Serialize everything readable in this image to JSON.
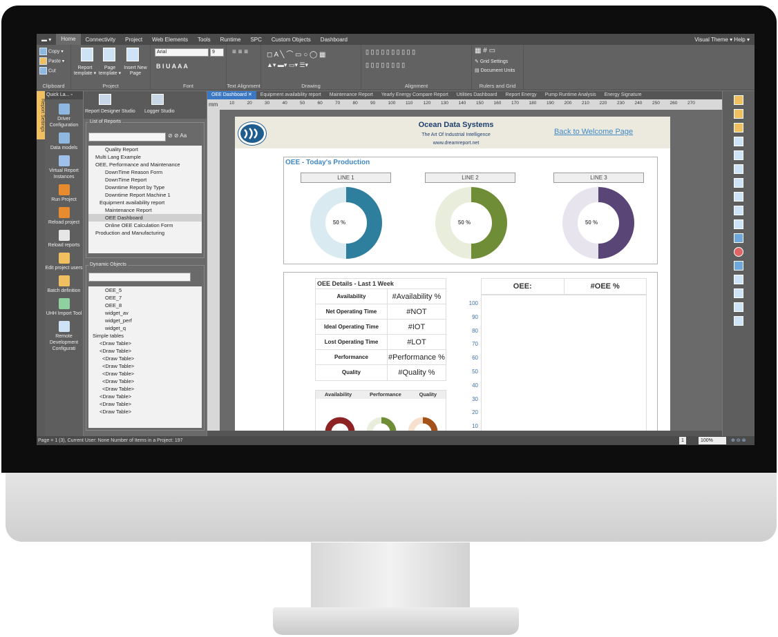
{
  "menu": {
    "items": [
      "Home",
      "Connectivity",
      "Project",
      "Web Elements",
      "Tools",
      "Runtime",
      "SPC",
      "Custom Objects",
      "Dashboard"
    ],
    "right": "Visual Theme ▾ Help ▾"
  },
  "ribbon": {
    "clipboard": {
      "copy": "Copy ▾",
      "paste": "Paste ▾",
      "cut": "Cut",
      "label": "Clipboard"
    },
    "project": {
      "report_template": "Report template ▾",
      "page_template": "Page template ▾",
      "insert_page": "Insert New Page",
      "label": "Project"
    },
    "font": {
      "family": "Arial",
      "size": "9",
      "label": "Font"
    },
    "text_alignment_label": "Text Alignment",
    "drawing_label": "Drawing",
    "alignment_label": "Alignment",
    "rulers": {
      "grid_settings": "Grid Settings",
      "document_units": "Document Units",
      "label": "Rulers and Grid"
    }
  },
  "left_strip": {
    "vertical_tab": "Report Settings"
  },
  "quick": {
    "header": "Quick La... ▫",
    "items": [
      "Driver Configuration",
      "Data models",
      "Virtual Report Instances",
      "Run Project",
      "Reload project",
      "Reload reports",
      "Edit project users",
      "Batch definition",
      "UHH Import Tool",
      "Remote Development Configurati"
    ]
  },
  "tree": {
    "tabs": [
      "Report Designer Studio",
      "Logger Studio"
    ],
    "reports_label": "List of Reports",
    "reports": [
      "Quality Report",
      "Multi Lang Example",
      "OEE, Performance and Maintenance",
      "DownTime Reason Form",
      "DownTime Report",
      "Downtime Report by Type",
      "Downtime Report Machine 1",
      "Equipment availability report",
      "Maintenance Report",
      "OEE Dashboard",
      "Online OEE Calculation Form",
      "Production and Manufacturing"
    ],
    "objects_label": "Dynamic Objects",
    "objects": [
      "OEE_5",
      "OEE_7",
      "OEE_8",
      "widget_av",
      "widget_perf",
      "widget_q",
      "Simple tables",
      "<Draw Table>",
      "<Draw Table>",
      "<Draw Table>",
      "<Draw Table>",
      "<Draw Table>",
      "<Draw Table>",
      "<Draw Table>",
      "<Draw Table>",
      "<Draw Table>",
      "<Draw Table>"
    ]
  },
  "doc": {
    "tabs": [
      "OEE Dashboard ✕",
      "Equipment availability report",
      "Maintenance Report",
      "Yearly Energy Compare Report",
      "Utilities Dashboard",
      "Report Energy",
      "Pump Runtime Analysis",
      "Energy Signature"
    ],
    "ruler_unit": "mm",
    "ruler_ticks": [
      "10",
      "20",
      "30",
      "40",
      "50",
      "60",
      "70",
      "80",
      "90",
      "100",
      "110",
      "120",
      "130",
      "140",
      "150",
      "160",
      "170",
      "180",
      "190",
      "200",
      "210",
      "220",
      "230",
      "240",
      "250",
      "260",
      "270"
    ]
  },
  "page": {
    "company": "Ocean Data Systems",
    "tagline": "The Art Of Industrial Intelligence",
    "website": "www.dreamreport.net",
    "back_link": "Back to Welcome Page",
    "oee_title": "OEE - Today's Production",
    "lines": [
      {
        "name": "LINE 1",
        "value": "50 %",
        "color": "#2e7f9e",
        "light": "#d9eaf1"
      },
      {
        "name": "LINE 2",
        "value": "50 %",
        "color": "#6f8d37",
        "light": "#e8eedb"
      },
      {
        "name": "LINE 3",
        "value": "50 %",
        "color": "#5a4577",
        "light": "#e8e4ee"
      }
    ],
    "details_title": "OEE Details - Last 1 Week",
    "details": [
      {
        "label": "Availability",
        "value": "#Availability %"
      },
      {
        "label": "Net Operating Time",
        "value": "#NOT"
      },
      {
        "label": "Ideal Operating Time",
        "value": "#IOT"
      },
      {
        "label": "Lost Operating Time",
        "value": "#LOT"
      },
      {
        "label": "Performance",
        "value": "#Performance %"
      },
      {
        "label": "Quality",
        "value": "#Quality %"
      }
    ],
    "gauges_header": [
      "Availability",
      "Performance",
      "Quality"
    ],
    "oee_label": "OEE:",
    "oee_value": "#OEE %",
    "y_ticks": [
      "100",
      "90",
      "80",
      "70",
      "60",
      "50",
      "40",
      "30",
      "20",
      "10"
    ]
  },
  "status": {
    "text": "Page = 1 (3), Current User: None  Number of Items in a Project: 197",
    "page": "1",
    "zoom": "100%"
  }
}
